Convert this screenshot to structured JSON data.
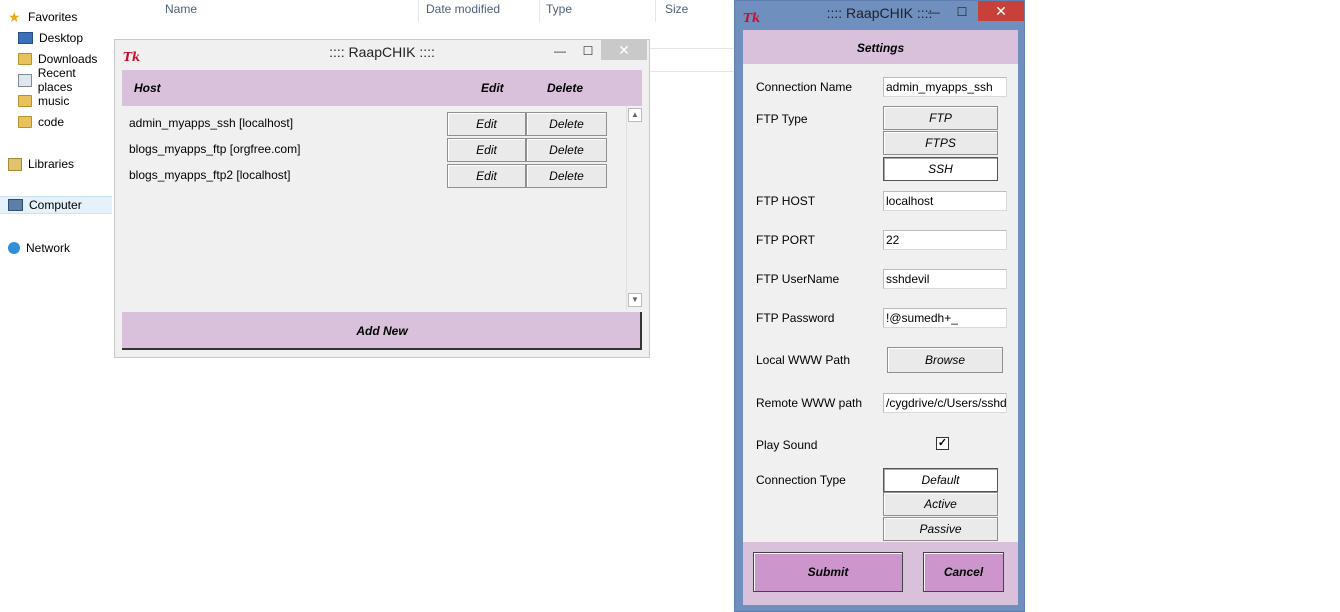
{
  "explorer": {
    "nav": [
      {
        "label": "Favorites",
        "icon": "star-icon"
      },
      {
        "label": "Desktop",
        "icon": "desktop-icon"
      },
      {
        "label": "Downloads",
        "icon": "downloads-folder-icon"
      },
      {
        "label": "Recent places",
        "icon": "recent-places-icon"
      },
      {
        "label": "music",
        "icon": "folder-icon"
      },
      {
        "label": "code",
        "icon": "folder-icon"
      },
      {
        "label": "Libraries",
        "icon": "libraries-icon"
      },
      {
        "label": "Computer",
        "icon": "computer-icon"
      },
      {
        "label": "Network",
        "icon": "network-icon"
      }
    ],
    "columns": [
      "Name",
      "Date modified",
      "Type",
      "Size"
    ]
  },
  "host_window": {
    "title": ":::: RaapCHIK ::::",
    "logo": "Tk",
    "minimize": "—",
    "maximize": "☐",
    "close": "✕",
    "headers": {
      "host": "Host",
      "edit": "Edit",
      "delete": "Delete"
    },
    "rows": [
      {
        "host": "admin_myapps_ssh [localhost]",
        "edit": "Edit",
        "delete": "Delete"
      },
      {
        "host": "blogs_myapps_ftp [orgfree.com]",
        "edit": "Edit",
        "delete": "Delete"
      },
      {
        "host": "blogs_myapps_ftp2 [localhost]",
        "edit": "Edit",
        "delete": "Delete"
      }
    ],
    "add_new": "Add New"
  },
  "settings_window": {
    "title": ":::: RaapCHIK ::::",
    "logo": "Tk",
    "minimize": "—",
    "maximize": "☐",
    "close": "✕",
    "heading": "Settings",
    "connection_name_label": "Connection Name",
    "connection_name_value": "admin_myapps_ssh",
    "ftp_type_label": "FTP Type",
    "ftp_types": [
      "FTP",
      "FTPS",
      "SSH"
    ],
    "ftp_type_selected": "SSH",
    "ftp_host_label": "FTP HOST",
    "ftp_host_value": "localhost",
    "ftp_port_label": "FTP PORT",
    "ftp_port_value": "22",
    "ftp_username_label": "FTP UserName",
    "ftp_username_value": "sshdevil",
    "ftp_password_label": "FTP Password",
    "ftp_password_value": "!@sumedh+_",
    "local_www_label": "Local WWW Path",
    "browse_label": "Browse",
    "remote_www_label": "Remote WWW path",
    "remote_www_value": "/cygdrive/c/Users/sshdevil",
    "play_sound_label": "Play Sound",
    "play_sound_checked": true,
    "check_mark": "✓",
    "connection_type_label": "Connection Type",
    "connection_types": [
      "Default",
      "Active",
      "Passive"
    ],
    "connection_type_selected": "Default",
    "submit_label": "Submit",
    "cancel_label": "Cancel"
  },
  "colors": {
    "accent": "#d9c1dc",
    "submit": "#cc96cc",
    "close": "#c7403a",
    "border_blue": "#6f8fbf"
  }
}
